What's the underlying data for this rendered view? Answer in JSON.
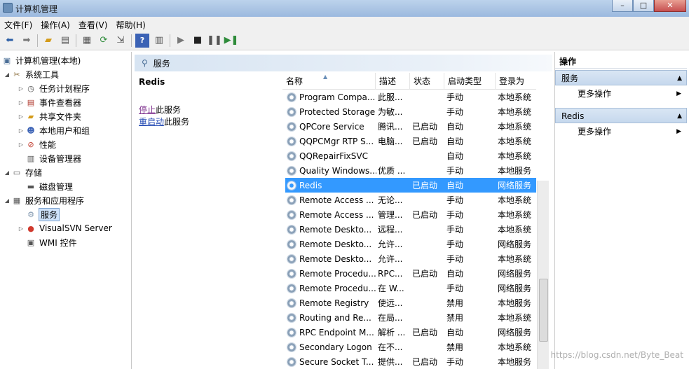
{
  "window": {
    "title": "计算机管理",
    "minimize": "–",
    "maximize": "□",
    "close": "✕"
  },
  "menu": [
    "文件(F)",
    "操作(A)",
    "查看(V)",
    "帮助(H)"
  ],
  "tree": {
    "root": "计算机管理(本地)",
    "system_tools": "系统工具",
    "task_scheduler": "任务计划程序",
    "event_viewer": "事件查看器",
    "shared_folders": "共享文件夹",
    "local_users": "本地用户和组",
    "performance": "性能",
    "device_manager": "设备管理器",
    "storage": "存储",
    "disk_management": "磁盘管理",
    "services_apps": "服务和应用程序",
    "services": "服务",
    "visualsvn": "VisualSVN Server",
    "wmi": "WMI 控件"
  },
  "middle": {
    "header": "服务",
    "selected_service": "Redis",
    "stop_link": "停止",
    "stop_suffix": "此服务",
    "restart_link": "重启动",
    "restart_suffix": "此服务"
  },
  "columns": {
    "name": "名称",
    "desc": "描述",
    "status": "状态",
    "startup": "启动类型",
    "logon": "登录为"
  },
  "services": [
    {
      "name": "Program Compa...",
      "desc": "此服...",
      "status": "",
      "startup": "手动",
      "logon": "本地系统"
    },
    {
      "name": "Protected Storage",
      "desc": "为敏...",
      "status": "",
      "startup": "手动",
      "logon": "本地系统"
    },
    {
      "name": "QPCore Service",
      "desc": "腾讯...",
      "status": "已启动",
      "startup": "自动",
      "logon": "本地系统"
    },
    {
      "name": "QQPCMgr RTP S...",
      "desc": "电脑...",
      "status": "已启动",
      "startup": "自动",
      "logon": "本地系统"
    },
    {
      "name": "QQRepairFixSVC",
      "desc": "",
      "status": "",
      "startup": "自动",
      "logon": "本地系统"
    },
    {
      "name": "Quality Windows...",
      "desc": "优质 ...",
      "status": "",
      "startup": "手动",
      "logon": "本地服务"
    },
    {
      "name": "Redis",
      "desc": "",
      "status": "已启动",
      "startup": "自动",
      "logon": "网络服务"
    },
    {
      "name": "Remote Access ...",
      "desc": "无论...",
      "status": "",
      "startup": "手动",
      "logon": "本地系统"
    },
    {
      "name": "Remote Access ...",
      "desc": "管理...",
      "status": "已启动",
      "startup": "手动",
      "logon": "本地系统"
    },
    {
      "name": "Remote Deskto...",
      "desc": "远程...",
      "status": "",
      "startup": "手动",
      "logon": "本地系统"
    },
    {
      "name": "Remote Deskto...",
      "desc": "允许...",
      "status": "",
      "startup": "手动",
      "logon": "网络服务"
    },
    {
      "name": "Remote Deskto...",
      "desc": "允许...",
      "status": "",
      "startup": "手动",
      "logon": "本地系统"
    },
    {
      "name": "Remote Procedu...",
      "desc": "RPC...",
      "status": "已启动",
      "startup": "自动",
      "logon": "网络服务"
    },
    {
      "name": "Remote Procedu...",
      "desc": "在 W...",
      "status": "",
      "startup": "手动",
      "logon": "网络服务"
    },
    {
      "name": "Remote Registry",
      "desc": "使远...",
      "status": "",
      "startup": "禁用",
      "logon": "本地服务"
    },
    {
      "name": "Routing and Re...",
      "desc": "在局...",
      "status": "",
      "startup": "禁用",
      "logon": "本地系统"
    },
    {
      "name": "RPC Endpoint M...",
      "desc": "解析 ...",
      "status": "已启动",
      "startup": "自动",
      "logon": "网络服务"
    },
    {
      "name": "Secondary Logon",
      "desc": "在不...",
      "status": "",
      "startup": "禁用",
      "logon": "本地系统"
    },
    {
      "name": "Secure Socket T...",
      "desc": "提供...",
      "status": "已启动",
      "startup": "手动",
      "logon": "本地服务"
    }
  ],
  "actions": {
    "title": "操作",
    "group1": "服务",
    "more1": "更多操作",
    "group2": "Redis",
    "more2": "更多操作"
  },
  "watermark": "https://blog.csdn.net/Byte_Beat"
}
